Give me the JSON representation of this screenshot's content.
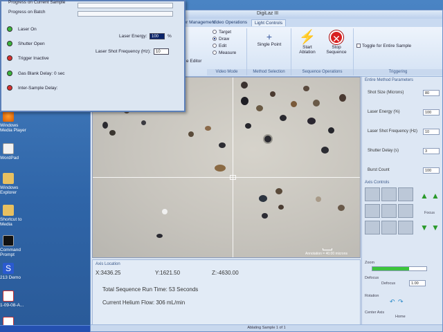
{
  "app": {
    "title": "DigiLaz III"
  },
  "desktop_icons": [
    {
      "name": "windows-media-player",
      "label": "Windows Media Player"
    },
    {
      "name": "wordpad",
      "label": "WordPad"
    },
    {
      "name": "windows-explorer",
      "label": "Windows Explorer"
    },
    {
      "name": "shortcut-to-media",
      "label": "Shortcut to Media"
    },
    {
      "name": "command-prompt",
      "label": "Command Prompt"
    },
    {
      "name": "demo",
      "label": "213 Demo"
    },
    {
      "name": "file-1",
      "label": "1-09-08-A..."
    },
    {
      "name": "file-2",
      "label": ""
    }
  ],
  "tabs": [
    "Laser Management",
    "Video Operations",
    "Light Controls"
  ],
  "ribbon": {
    "editor_label": "e Editor",
    "video_mode_options": [
      "Target",
      "Draw",
      "Edit",
      "Measure"
    ],
    "video_mode_selected": "Draw",
    "video_mode_group": "Video Mode",
    "method_selection_button": "Single Point",
    "method_selection_group": "Method Selection",
    "start_ablation": "Start Ablation",
    "stop_sequence": "Stop Sequence",
    "sequence_operations_group": "Sequence Operations",
    "toggle_label": "Toggle for Entire Sample",
    "triggering_group": "Triggering"
  },
  "axis_location": {
    "label": "Axis Location",
    "x": "X:3436.25",
    "y": "Y:1621.50",
    "z": "Z:-4630.00"
  },
  "run_info": {
    "sequence_time": "Total Sequence Run Time:  53 Seconds",
    "helium_flow": "Current Helium Flow:  306 mL/min"
  },
  "scale_text": "Annotation = 40.00 microns",
  "right_panel": {
    "title": "Entire Method Parameters",
    "params": [
      {
        "label": "Shot Size (Microns)",
        "value": "80"
      },
      {
        "label": "Laser Energy (%)",
        "value": "100"
      },
      {
        "label": "Laser Shot Frequency (Hz)",
        "value": "10"
      },
      {
        "label": "Shutter Delay (s)",
        "value": "3"
      },
      {
        "label": "Burst Count",
        "value": "100"
      }
    ],
    "axis_controls": "Axis Controls",
    "focus": "Focus",
    "zoom": "Zoom",
    "zoom_percent": 68,
    "defocus_label": "Defocus",
    "defocus_value": "1.00",
    "rotation": "Rotation",
    "center_axis": "Center Axis",
    "home": "Home"
  },
  "status_bar": "Ablating Sample 1 of 1",
  "status_window": {
    "progress_current_sample": "Progress on Current Sample",
    "progress_batch": "Progress on Batch",
    "indicators": [
      {
        "label": "Laser On",
        "color": "#3cb43c"
      },
      {
        "label": "Shutter Open",
        "color": "#3cb43c"
      },
      {
        "label": "Trigger Inactive",
        "color": "#d83030"
      },
      {
        "label": "Gas Blank Delay: 0 sec",
        "color": "#3cb43c"
      },
      {
        "label": "Inter-Sample Delay:",
        "color": "#d83030"
      }
    ],
    "laser_energy_label": "Laser Energy:",
    "laser_energy_value": "100",
    "laser_energy_unit": "%",
    "laser_freq_label": "Laser Shot Frequency (Hz):",
    "laser_freq_value": "10"
  }
}
